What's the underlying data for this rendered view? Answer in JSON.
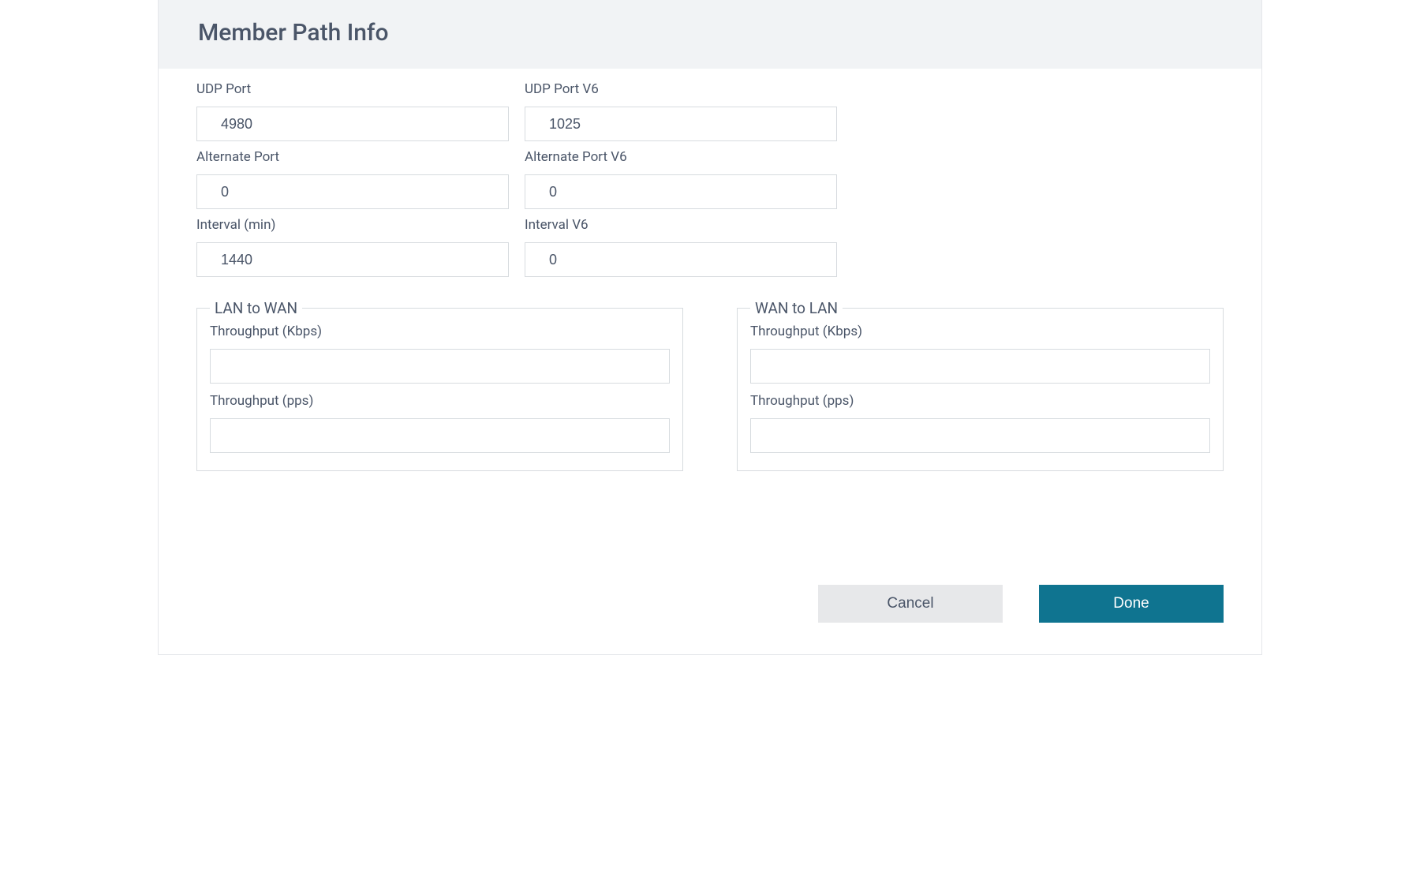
{
  "header": {
    "title": "Member Path Info"
  },
  "fields": {
    "udp_port": {
      "label": "UDP Port",
      "value": "4980"
    },
    "udp_port_v6": {
      "label": "UDP Port V6",
      "value": "1025"
    },
    "alternate_port": {
      "label": "Alternate Port",
      "value": "0"
    },
    "alternate_port_v6": {
      "label": "Alternate Port V6",
      "value": "0"
    },
    "interval": {
      "label": "Interval (min)",
      "value": "1440"
    },
    "interval_v6": {
      "label": "Interval V6",
      "value": "0"
    }
  },
  "lan_to_wan": {
    "legend": "LAN to WAN",
    "throughput_kbps": {
      "label": "Throughput (Kbps)",
      "value": ""
    },
    "throughput_pps": {
      "label": "Throughput (pps)",
      "value": ""
    }
  },
  "wan_to_lan": {
    "legend": "WAN to LAN",
    "throughput_kbps": {
      "label": "Throughput (Kbps)",
      "value": ""
    },
    "throughput_pps": {
      "label": "Throughput (pps)",
      "value": ""
    }
  },
  "footer": {
    "cancel_label": "Cancel",
    "done_label": "Done"
  }
}
